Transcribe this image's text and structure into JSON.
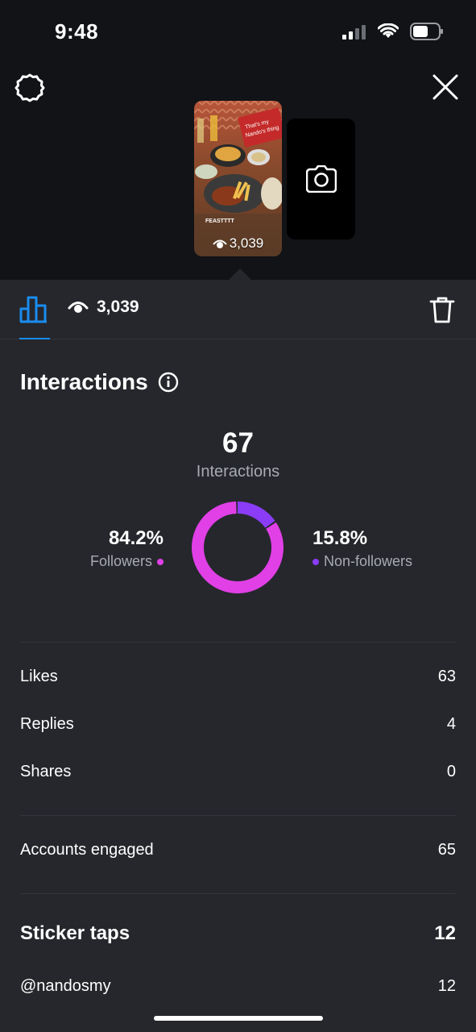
{
  "status_bar": {
    "time": "9:48"
  },
  "story": {
    "caption": "FEASTTTT",
    "sign_text": "That's my Nando's thing",
    "views": "3,039"
  },
  "tabs": {
    "views_count": "3,039"
  },
  "interactions": {
    "title": "Interactions",
    "total": "67",
    "total_label": "Interactions",
    "followers_pct": "84.2%",
    "followers_label": "Followers",
    "non_followers_pct": "15.8%",
    "non_followers_label": "Non-followers",
    "followers_fraction": 0.842,
    "non_followers_fraction": 0.158
  },
  "metrics": [
    {
      "label": "Likes",
      "value": "63"
    },
    {
      "label": "Replies",
      "value": "4"
    },
    {
      "label": "Shares",
      "value": "0"
    }
  ],
  "accounts_engaged": {
    "label": "Accounts engaged",
    "value": "65"
  },
  "sticker_taps": {
    "label": "Sticker taps",
    "value": "12",
    "items": [
      {
        "label": "@nandosmy",
        "value": "12"
      }
    ]
  },
  "icons": {
    "settings": "gear-icon",
    "close": "close-icon",
    "camera": "camera-icon",
    "insights": "bar-chart-icon",
    "views": "eye-icon",
    "delete": "trash-icon",
    "info": "info-icon"
  },
  "colors": {
    "followers": "#e040e6",
    "non_followers": "#8a3cf6",
    "accent": "#1a8cf0"
  }
}
